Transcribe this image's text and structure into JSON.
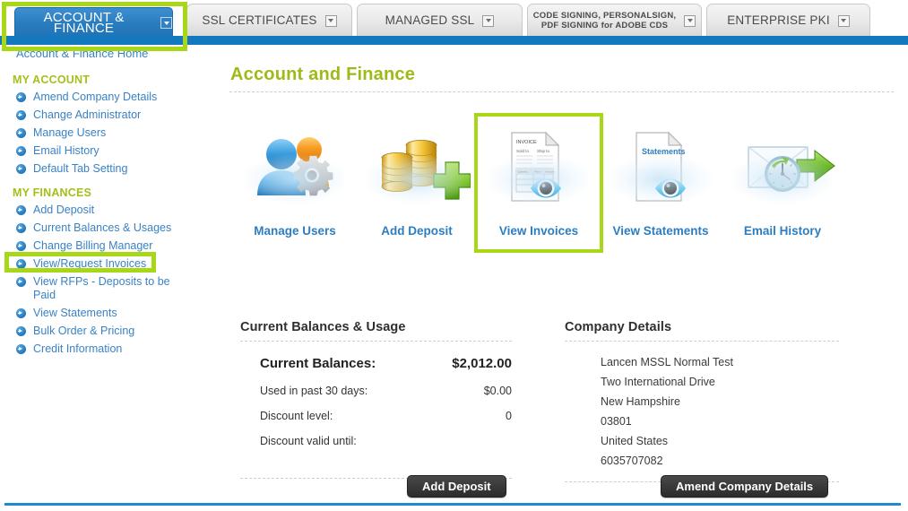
{
  "tabs": [
    {
      "label": "ACCOUNT & FINANCE",
      "caret": "caret-down-icon",
      "active": true
    },
    {
      "label": "SSL CERTIFICATES",
      "caret": "caret-down-icon",
      "active": false
    },
    {
      "label": "MANAGED SSL",
      "caret": "caret-down-icon",
      "active": false
    },
    {
      "label": "CODE SIGNING, PERSONALSIGN,\nPDF SIGNING for ADOBE CDS",
      "line1": "CODE SIGNING, PERSONALSIGN,",
      "line2": "PDF SIGNING for ADOBE CDS",
      "caret": "caret-down-icon",
      "active": false
    },
    {
      "label": "ENTERPRISE PKI",
      "caret": "caret-down-icon",
      "active": false
    }
  ],
  "sidebar": {
    "home_link": "Account & Finance Home",
    "groups": [
      {
        "title": "MY ACCOUNT",
        "items": [
          {
            "label": "Amend Company Details"
          },
          {
            "label": "Change Administrator"
          },
          {
            "label": "Manage Users"
          },
          {
            "label": "Email History"
          },
          {
            "label": "Default Tab Setting"
          }
        ]
      },
      {
        "title": "MY FINANCES",
        "items": [
          {
            "label": "Add Deposit"
          },
          {
            "label": "Current Balances & Usages"
          },
          {
            "label": "Change Billing Manager"
          },
          {
            "label": "View/Request Invoices",
            "highlighted": true
          },
          {
            "label": "View RFPs - Deposits to be Paid"
          },
          {
            "label": "View Statements"
          },
          {
            "label": "Bulk Order & Pricing"
          },
          {
            "label": "Credit Information"
          }
        ]
      }
    ]
  },
  "main": {
    "page_title": "Account and Finance",
    "tiles": [
      {
        "caption": "Manage Users",
        "icon": "users-gear-icon",
        "highlighted": false
      },
      {
        "caption": "Add Deposit",
        "icon": "coins-plus-icon",
        "highlighted": false
      },
      {
        "caption": "View Invoices",
        "icon": "invoice-eye-icon",
        "highlighted": true,
        "doc_title": "INVOICE",
        "doc_f1": "Sold to",
        "doc_f2": "Ship to",
        "doc_c1": "Quantity",
        "doc_c2": "Price",
        "doc_c3": "Amount"
      },
      {
        "caption": "View Statements",
        "icon": "statements-eye-icon",
        "highlighted": false,
        "doc_title": "Statements"
      },
      {
        "caption": "Email History",
        "icon": "envelope-clock-arrow-icon",
        "highlighted": false
      }
    ],
    "balances": {
      "title": "Current Balances & Usage",
      "rows": [
        {
          "label": "Current Balances:",
          "value": "$2,012.00",
          "strong": true
        },
        {
          "label": "Used in past 30 days:",
          "value": "$0.00",
          "strong": false
        },
        {
          "label": "Discount level:",
          "value": "0",
          "strong": false
        },
        {
          "label": "Discount valid until:",
          "value": "",
          "strong": false
        }
      ],
      "button": "Add Deposit"
    },
    "company": {
      "title": "Company Details",
      "lines": [
        "Lancen MSSL Normal Test",
        "Two International Drive",
        "New Hampshire",
        "03801",
        "United States",
        "6035707082"
      ],
      "button": "Amend Company Details"
    }
  },
  "colors": {
    "accent_blue": "#1378bd",
    "highlight_green": "#a7d716",
    "title_green": "#9dbb17",
    "link_blue": "#3a82c4"
  }
}
